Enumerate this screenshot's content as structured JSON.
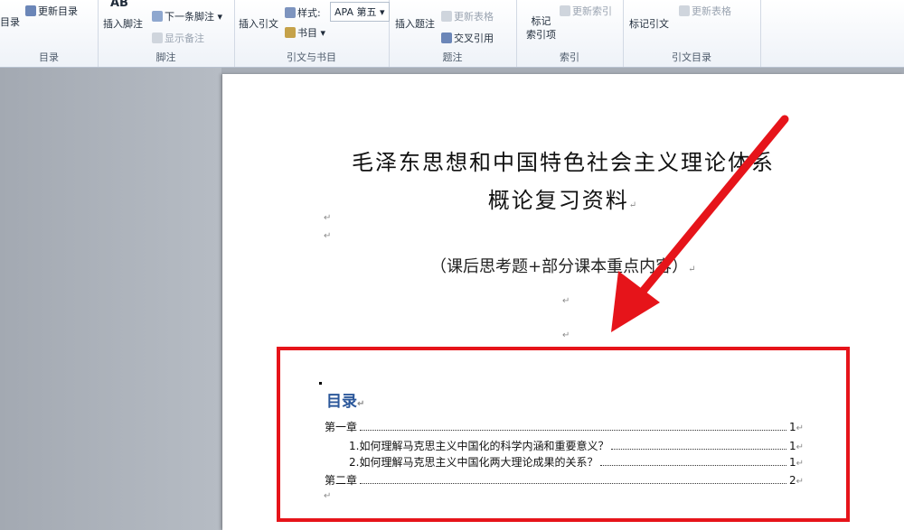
{
  "ribbon": {
    "toc_group": {
      "toc_button": "目录",
      "update_toc": "更新目录",
      "label": "目录"
    },
    "footnotes_group": {
      "insert_footnote": "插入脚注",
      "ab_icon": "AB",
      "next_footnote": "下一条脚注 ▾",
      "show_notes": "显示备注",
      "label": "脚注"
    },
    "citations_group": {
      "insert_citation": "插入引文",
      "style_label": "样式:",
      "style_value": "APA 第五",
      "bibliography": "书目 ▾",
      "label": "引文与书目"
    },
    "captions_group": {
      "insert_caption": "插入题注",
      "update_table": "更新表格",
      "cross_reference": "交叉引用",
      "label": "题注"
    },
    "index_group": {
      "mark_entry_line1": "标记",
      "mark_entry_line2": "索引项",
      "update_index": "更新索引",
      "label": "索引"
    },
    "authorities_group": {
      "mark_citation": "标记引文",
      "update_table": "更新表格",
      "label": "引文目录"
    }
  },
  "document": {
    "title_line1": "毛泽东思想和中国特色社会主义理论体系",
    "title_line2": "概论复习资料",
    "subtitle": "（课后思考题+部分课本重点内容）",
    "paragraph_mark": "↵",
    "toc": {
      "heading": "目录",
      "entries": [
        {
          "text": "第一章",
          "page": "1"
        },
        {
          "text": "1.如何理解马克思主义中国化的科学内涵和重要意义？",
          "page": "1"
        },
        {
          "text": "2.如何理解马克思主义中国化两大理论成果的关系？",
          "page": "1"
        },
        {
          "text": "第二章",
          "page": "2"
        }
      ]
    }
  },
  "colors": {
    "annotation_red": "#e6141a",
    "heading_blue": "#2b579a"
  }
}
